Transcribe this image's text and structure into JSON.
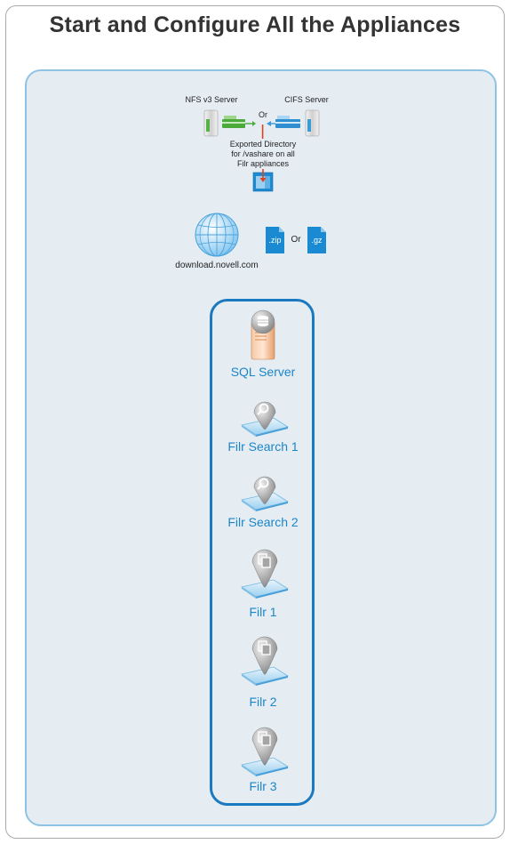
{
  "title": "Start and Configure All the Appliances",
  "storage": {
    "nfs_label": "NFS v3 Server",
    "cifs_label": "CIFS Server",
    "or_label": "Or",
    "exported_dir_lines": [
      "Exported Directory",
      "for /vashare on all",
      "Filr appliances"
    ]
  },
  "download": {
    "site_label": "download.novell.com",
    "zip_label": ".zip",
    "gz_label": ".gz",
    "or_label": "Or"
  },
  "appliances": [
    {
      "label": "SQL Server",
      "icon": "sql-server-icon"
    },
    {
      "label": "Filr Search 1",
      "icon": "search-appliance-icon"
    },
    {
      "label": "Filr Search 2",
      "icon": "search-appliance-icon"
    },
    {
      "label": "Filr 1",
      "icon": "filr-appliance-icon"
    },
    {
      "label": "Filr 2",
      "icon": "filr-appliance-icon"
    },
    {
      "label": "Filr 3",
      "icon": "filr-appliance-icon"
    }
  ],
  "colors": {
    "panel_bg": "#e5edf3",
    "panel_border": "#8fc3e6",
    "stack_border": "#1b79bf",
    "label_blue": "#1c85c8",
    "arrow_red": "#e2401f",
    "green": "#4aab3a"
  }
}
